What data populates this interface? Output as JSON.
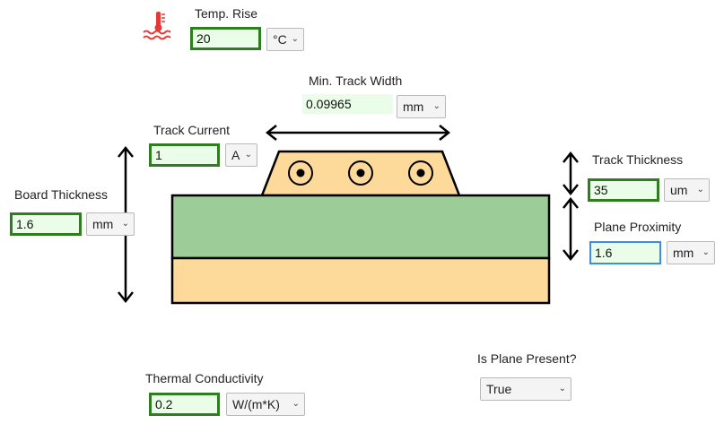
{
  "temp_rise": {
    "label": "Temp. Rise",
    "value": "20",
    "unit": "°C",
    "icon": "thermometer-heat-icon"
  },
  "min_track_width": {
    "label": "Min. Track Width",
    "value": "0.09965",
    "unit": "mm"
  },
  "track_current": {
    "label": "Track Current",
    "value": "1",
    "unit": "A"
  },
  "track_thickness": {
    "label": "Track Thickness",
    "value": "35",
    "unit": "um"
  },
  "board_thickness": {
    "label": "Board Thickness",
    "value": "1.6",
    "unit": "mm"
  },
  "plane_proximity": {
    "label": "Plane Proximity",
    "value": "1.6",
    "unit": "mm"
  },
  "thermal_conductivity": {
    "label": "Thermal Conductivity",
    "value": "0.2",
    "unit": "W/(m*K)"
  },
  "plane_present": {
    "label": "Is Plane Present?",
    "value": "True"
  },
  "colors": {
    "board_green": "#9ccc97",
    "board_copper": "#fdd99a",
    "track": "#fdd99a",
    "field_border": "#2e7d1f",
    "field_bg": "#e9fde9",
    "focus_border": "#3c8fde",
    "icon_red": "#e53935"
  }
}
